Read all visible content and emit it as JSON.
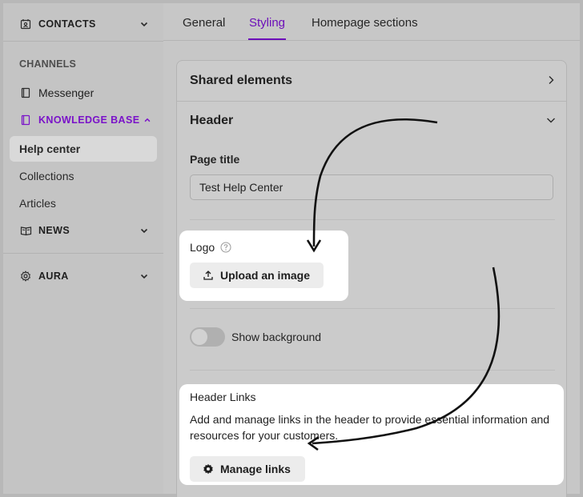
{
  "sidebar": {
    "contacts": {
      "label": "CONTACTS"
    },
    "channels_label": "CHANNELS",
    "messenger": {
      "label": "Messenger"
    },
    "knowledge_base": {
      "label": "KNOWLEDGE BASE"
    },
    "kb_items": [
      {
        "label": "Help center",
        "active": true
      },
      {
        "label": "Collections"
      },
      {
        "label": "Articles"
      }
    ],
    "news": {
      "label": "NEWS"
    },
    "aura": {
      "label": "AURA"
    }
  },
  "tabs": [
    {
      "label": "General"
    },
    {
      "label": "Styling",
      "active": true
    },
    {
      "label": "Homepage sections"
    }
  ],
  "card": {
    "shared_elements": "Shared elements",
    "header": "Header",
    "page_title_label": "Page title",
    "page_title_value": "Test Help Center",
    "logo_label": "Logo",
    "upload_button": "Upload an image",
    "show_background_label": "Show background",
    "header_links_title": "Header Links",
    "header_links_description": "Add and manage links in the header to provide essential information and resources for your customers.",
    "manage_links_button": "Manage links"
  },
  "colors": {
    "accent": "#6c0fb9",
    "highlight": "#ffffff"
  },
  "icons": [
    "contacts-icon",
    "book-icon",
    "knowledge-base-icon",
    "news-icon",
    "gear-icon",
    "chevron-down-icon",
    "chevron-right-icon",
    "help-icon",
    "upload-icon",
    "settings-icon"
  ]
}
